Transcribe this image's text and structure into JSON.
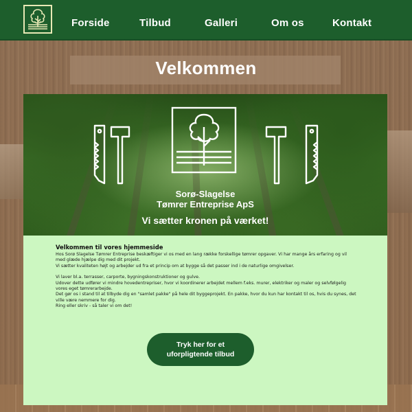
{
  "nav": {
    "items": [
      {
        "label": "Forside"
      },
      {
        "label": "Tilbud"
      },
      {
        "label": "Galleri"
      },
      {
        "label": "Om os"
      },
      {
        "label": "Kontakt"
      }
    ]
  },
  "welcome": {
    "title": "Velkommen"
  },
  "hero": {
    "company_line1": "Sorø-Slagelse",
    "company_line2": "Tømrer Entreprise ApS",
    "tagline": "Vi sætter kronen på værket!"
  },
  "content": {
    "heading": "Velkommen til vores hjemmeside",
    "paragraph1": [
      "Hos Sorø Slagelse Tømrer Entreprise beskæftiger vi os med en lang række forskellige tømrer opgaver. Vi har mange års erfaring og vil med glæde hjælpe dig med dit projekt.",
      "Vi sætter kvaliteten højt og arbejder ud fra et princip om at bygge så det passer ind i de naturlige omgivelser."
    ],
    "paragraph2": [
      "Vi laver bl.a. terrasser, carporte, bygningskonstruktioner og gulve.",
      "Udover dette udfører vi mindre hovedentrepriser, hvor vi koordinerer arbejdet mellem f.eks. murer, elektriker og maler og selvfølgelig vores eget tømrerarbejde.",
      "Det gør os i stand til at tilbyde dig en \"samlet pakke\" på hele dit byggeprojekt. En pakke, hvor du kun har kontakt til os, hvis du synes, det ville være nemmere for dig.",
      "Ring eller skriv - så taler vi om det!"
    ],
    "cta_label": "Tryk her for et\nuforpligtende tilbud"
  },
  "colors": {
    "nav_green": "#1d5e2c",
    "content_bg": "#ccf7c1",
    "logo_cream": "#e9eab6"
  },
  "icons": {
    "logo": "tree-logo-icon",
    "left_tool": "saw-hammer-icon",
    "right_tool": "hammer-saw-icon"
  }
}
